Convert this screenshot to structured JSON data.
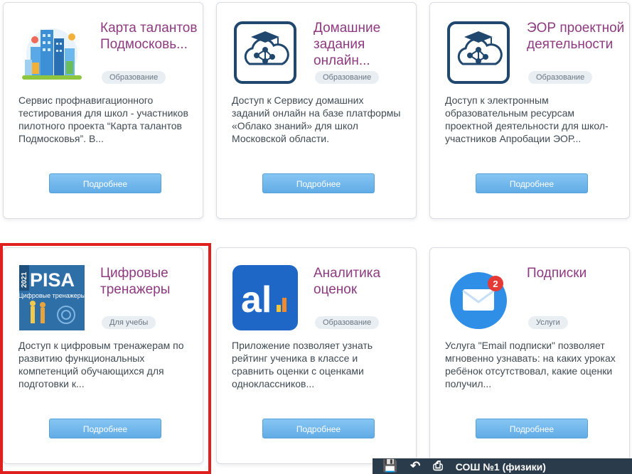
{
  "cards": [
    {
      "title": "Карта талантов Подмосковь...",
      "badge": "Образование",
      "description": "Сервис профнавигационного тестирования для школ - участников пилотного проекта “Карта талантов Подмосковья”. В...",
      "button": "Подробнее",
      "icon": "city-buildings-icon"
    },
    {
      "title": "Домашние задания онлайн...",
      "badge": "Образование",
      "description": "Доступ к Сервису домашних заданий онлайн на базе платформы «Облако знаний» для школ Московской области.",
      "button": "Подробнее",
      "icon": "cloud-graduation-icon"
    },
    {
      "title": "ЭОР проектной деятельности",
      "badge": "Образование",
      "description": "Доступ к электронным образовательным ресурсам проектной деятельности для школ-участников Апробации ЭОР...",
      "button": "Подробнее",
      "icon": "cloud-graduation-icon"
    },
    {
      "title": "Цифровые тренажеры",
      "badge": "Для учебы",
      "description": "Доступ к цифровым тренажерам по развитию функциональных компетенций обучающихся для подготовки к...",
      "button": "Подробнее",
      "icon": "pisa-icon",
      "icon_year": "2021",
      "icon_word": "PISA",
      "icon_caption": "Цифровые тренажеры"
    },
    {
      "title": "Аналитика оценок",
      "badge": "Образование",
      "description": "Приложение позволяет узнать рейтинг ученика в классе и сравнить оценки с оценками одноклассников...",
      "button": "Подробнее",
      "icon": "analytics-app-icon",
      "icon_text": "al"
    },
    {
      "title": "Подписки",
      "badge": "Услуги",
      "description": "Услуга \"Email подписки\" позволяет мгновенно узнавать: на каких уроках ребёнок отсутствовал, какие оценки получил...",
      "button": "Подробнее",
      "icon": "email-notification-icon",
      "notification_count": "2"
    }
  ],
  "taskbar": {
    "title": "СОШ №1 (физики)"
  },
  "colors": {
    "title": "#8e3a80",
    "button": "#6ab4eb",
    "highlight": "#e01f1f",
    "navy_icon": "#20476e"
  }
}
